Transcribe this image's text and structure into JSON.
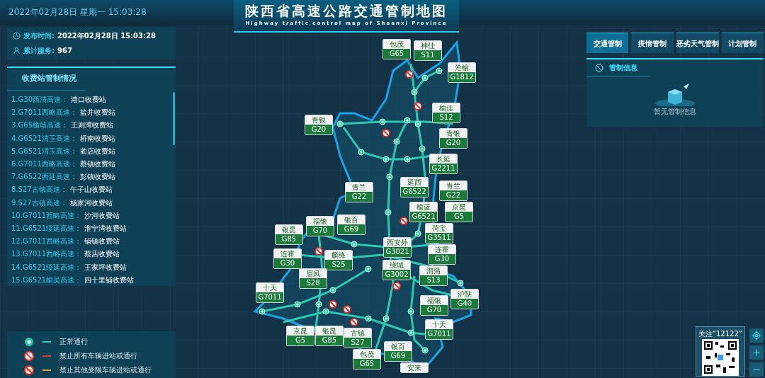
{
  "header": {
    "datetime": "2022年02月28日 星期一  15:03:28",
    "title": "陕西省高速公路交通管制地图",
    "subtitle": "Highway traffic control map of Shaanxi Province"
  },
  "info": [
    {
      "kind": "time",
      "label": "发布时间:",
      "value": "2022年02月28日  15:03:28"
    },
    {
      "kind": "service",
      "label": "累计服务:",
      "value": "967"
    }
  ],
  "stations": {
    "title": "收费站管制情况",
    "items": [
      {
        "road": "1.G30西渭高速：",
        "station": "港口收费站"
      },
      {
        "road": "2.G7011西略高速：",
        "station": "盐井收费站"
      },
      {
        "road": "3.G65榆靖高速：",
        "station": "王则湾收费站"
      },
      {
        "road": "4.G6521渭玉高速：",
        "station": "桥南收费站"
      },
      {
        "road": "5.G6521渭玉高速：",
        "station": "蔺店收费站"
      },
      {
        "road": "6.G7011西略高速：",
        "station": "蔡镇收费站"
      },
      {
        "road": "7.G6522西延高速：",
        "station": "彭镇收费站"
      },
      {
        "road": "8.S27古镇高速：",
        "station": "午子山收费站"
      },
      {
        "road": "9.S27古镇高速：",
        "station": "杨家河收费站"
      },
      {
        "road": "10.G7011西略高速：",
        "station": "沙河收费站"
      },
      {
        "road": "11.G6521绥延高速：",
        "station": "淮宁湾收费站"
      },
      {
        "road": "12.G7011西略高速：",
        "station": "铺镇收费站"
      },
      {
        "road": "13.G7011西略高速：",
        "station": "蔡店收费站"
      },
      {
        "road": "14.G6521绥延高速：",
        "station": "王家坪收费站"
      },
      {
        "road": "15.G6521榆吴高速：",
        "station": "四十里铺收费站"
      }
    ]
  },
  "legend": [
    {
      "kind": "normal",
      "color": "#2bc9b0",
      "label": "正常通行"
    },
    {
      "kind": "ban_all",
      "color": "#e53935",
      "label": "禁止所有车辆进站或通行"
    },
    {
      "kind": "ban_other",
      "color": "#f0a040",
      "label": "禁止其他受限车辆进站或通行"
    }
  ],
  "control_tabs": [
    {
      "label": "交通管制",
      "selected": true
    },
    {
      "label": "疫情管制",
      "selected": false
    },
    {
      "label": "恶劣天气管制",
      "selected": false
    },
    {
      "label": "计划管制",
      "selected": false
    }
  ],
  "control_panel": {
    "title": "管制信息",
    "empty_text": "暂无管制信息"
  },
  "map": {
    "shields": [
      {
        "name": "包茂",
        "code": "G65"
      },
      {
        "name": "神佳",
        "code": "S11"
      },
      {
        "name": "沧榆",
        "code": "G1812"
      },
      {
        "name": "青银",
        "code": "G20"
      },
      {
        "name": "榆佳",
        "code": "S12"
      },
      {
        "name": "青银",
        "code": "G20"
      },
      {
        "name": "长延",
        "code": "G2211"
      },
      {
        "name": "青兰",
        "code": "G22"
      },
      {
        "name": "延西",
        "code": "G6522"
      },
      {
        "name": "青兰",
        "code": "G22"
      },
      {
        "name": "榆蓝",
        "code": "G6521"
      },
      {
        "name": "京昆",
        "code": "G5"
      },
      {
        "name": "银昆",
        "code": "G85"
      },
      {
        "name": "福银",
        "code": "G70"
      },
      {
        "name": "银百",
        "code": "G69"
      },
      {
        "name": "菏宝",
        "code": "G3511"
      },
      {
        "name": "西安外",
        "code": "G3021"
      },
      {
        "name": "连霍",
        "code": "G30"
      },
      {
        "name": "麟绛",
        "code": "S25"
      },
      {
        "name": "眉凤",
        "code": "S28"
      },
      {
        "name": "绕城",
        "code": "G3002"
      },
      {
        "name": "连霍",
        "code": "G30"
      },
      {
        "name": "渭蒲",
        "code": "S13"
      },
      {
        "name": "十天",
        "code": "G7011"
      },
      {
        "name": "沪陕",
        "code": "G40"
      },
      {
        "name": "福银",
        "code": "G70"
      },
      {
        "name": "十天",
        "code": "G7011"
      },
      {
        "name": "京昆",
        "code": "G5"
      },
      {
        "name": "银昆",
        "code": "G85"
      },
      {
        "name": "古镇",
        "code": "S27"
      },
      {
        "name": "包茂",
        "code": "G65"
      },
      {
        "name": "银百",
        "code": "G69"
      },
      {
        "name": "安来"
      }
    ]
  },
  "qr": {
    "caption": "关注“12122”"
  }
}
